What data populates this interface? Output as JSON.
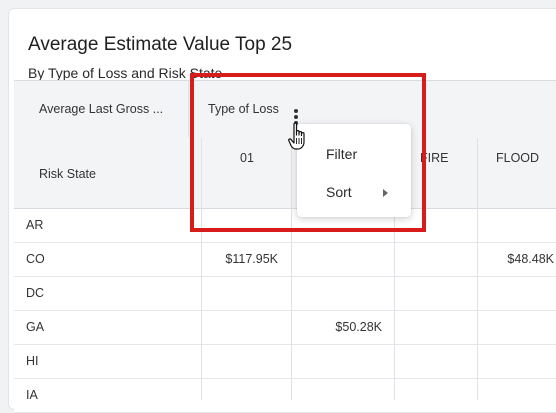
{
  "card": {
    "title": "Average Estimate Value Top 25",
    "subtitle": "By Type of Loss and Risk State"
  },
  "table": {
    "header_group": "Average Last Gross ...",
    "header_pivot": "Type of Loss",
    "row_header": "Risk State",
    "columns": [
      "01",
      "",
      "FIRE",
      "FLOOD"
    ],
    "rows": [
      {
        "state": "AR",
        "values": [
          "",
          "",
          "",
          ""
        ]
      },
      {
        "state": "CO",
        "values": [
          "$117.95K",
          "",
          "",
          "$48.48K"
        ]
      },
      {
        "state": "DC",
        "values": [
          "",
          "",
          "",
          ""
        ]
      },
      {
        "state": "GA",
        "values": [
          "",
          "$50.28K",
          "",
          ""
        ]
      },
      {
        "state": "HI",
        "values": [
          "",
          "",
          "",
          ""
        ]
      },
      {
        "state": "IA",
        "values": [
          "",
          "",
          "",
          ""
        ]
      }
    ]
  },
  "context_menu": {
    "items": [
      {
        "label": "Filter",
        "has_submenu": false
      },
      {
        "label": "Sort",
        "has_submenu": true
      }
    ]
  },
  "colors": {
    "highlight": "#d81b1b",
    "header_bg": "#f3f4f6",
    "page_bg": "#f1f2f4"
  },
  "icons": {
    "column_menu": "kebab-vertical-icon",
    "cursor": "hand-pointer-icon",
    "submenu": "caret-right-icon"
  }
}
